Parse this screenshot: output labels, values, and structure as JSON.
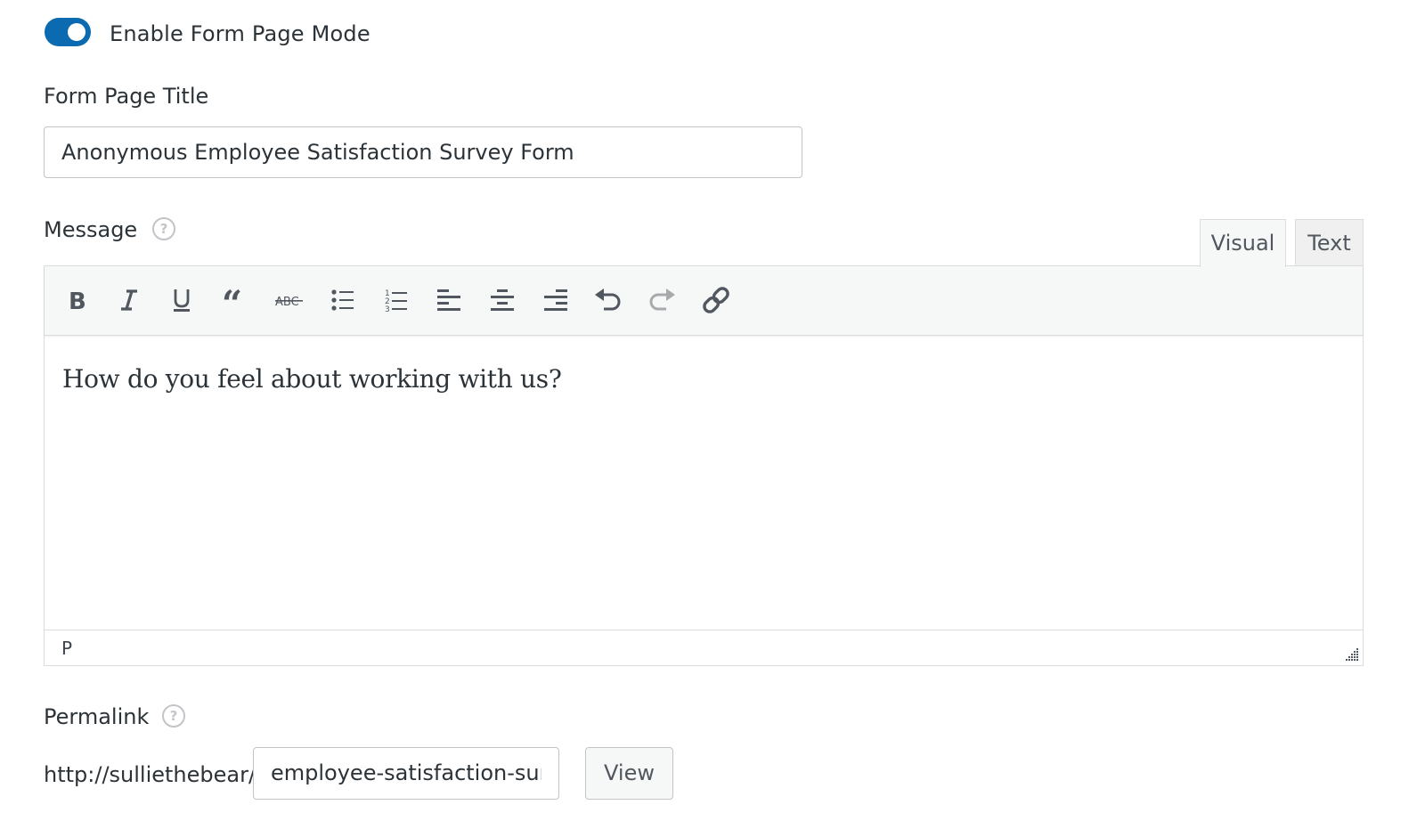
{
  "form_page_mode": {
    "toggle_label": "Enable Form Page Mode",
    "enabled": true,
    "toggle_color": "#0b6ab0"
  },
  "form_page_title": {
    "label": "Form Page Title",
    "value": "Anonymous Employee Satisfaction Survey Form"
  },
  "message": {
    "label": "Message",
    "help_icon": "question-circle-icon",
    "tabs": [
      {
        "label": "Visual",
        "active": true
      },
      {
        "label": "Text",
        "active": false
      }
    ],
    "toolbar": [
      {
        "name": "bold",
        "icon": "bold-icon"
      },
      {
        "name": "italic",
        "icon": "italic-icon"
      },
      {
        "name": "underline",
        "icon": "underline-icon"
      },
      {
        "name": "blockquote",
        "icon": "blockquote-icon"
      },
      {
        "name": "strikethrough",
        "icon": "strikethrough-icon"
      },
      {
        "name": "bulleted-list",
        "icon": "bullet-list-icon"
      },
      {
        "name": "numbered-list",
        "icon": "numbered-list-icon"
      },
      {
        "name": "align-left",
        "icon": "align-left-icon"
      },
      {
        "name": "align-center",
        "icon": "align-center-icon"
      },
      {
        "name": "align-right",
        "icon": "align-right-icon"
      },
      {
        "name": "undo",
        "icon": "undo-icon"
      },
      {
        "name": "redo",
        "icon": "redo-icon",
        "disabled": true
      },
      {
        "name": "insert-link",
        "icon": "link-icon"
      }
    ],
    "content": "How do you feel about working with us?",
    "status_path": "P"
  },
  "permalink": {
    "label": "Permalink",
    "help_icon": "question-circle-icon",
    "url_prefix": "http://sulliethebear/",
    "slug_value": "employee-satisfaction-sur",
    "view_label": "View"
  }
}
